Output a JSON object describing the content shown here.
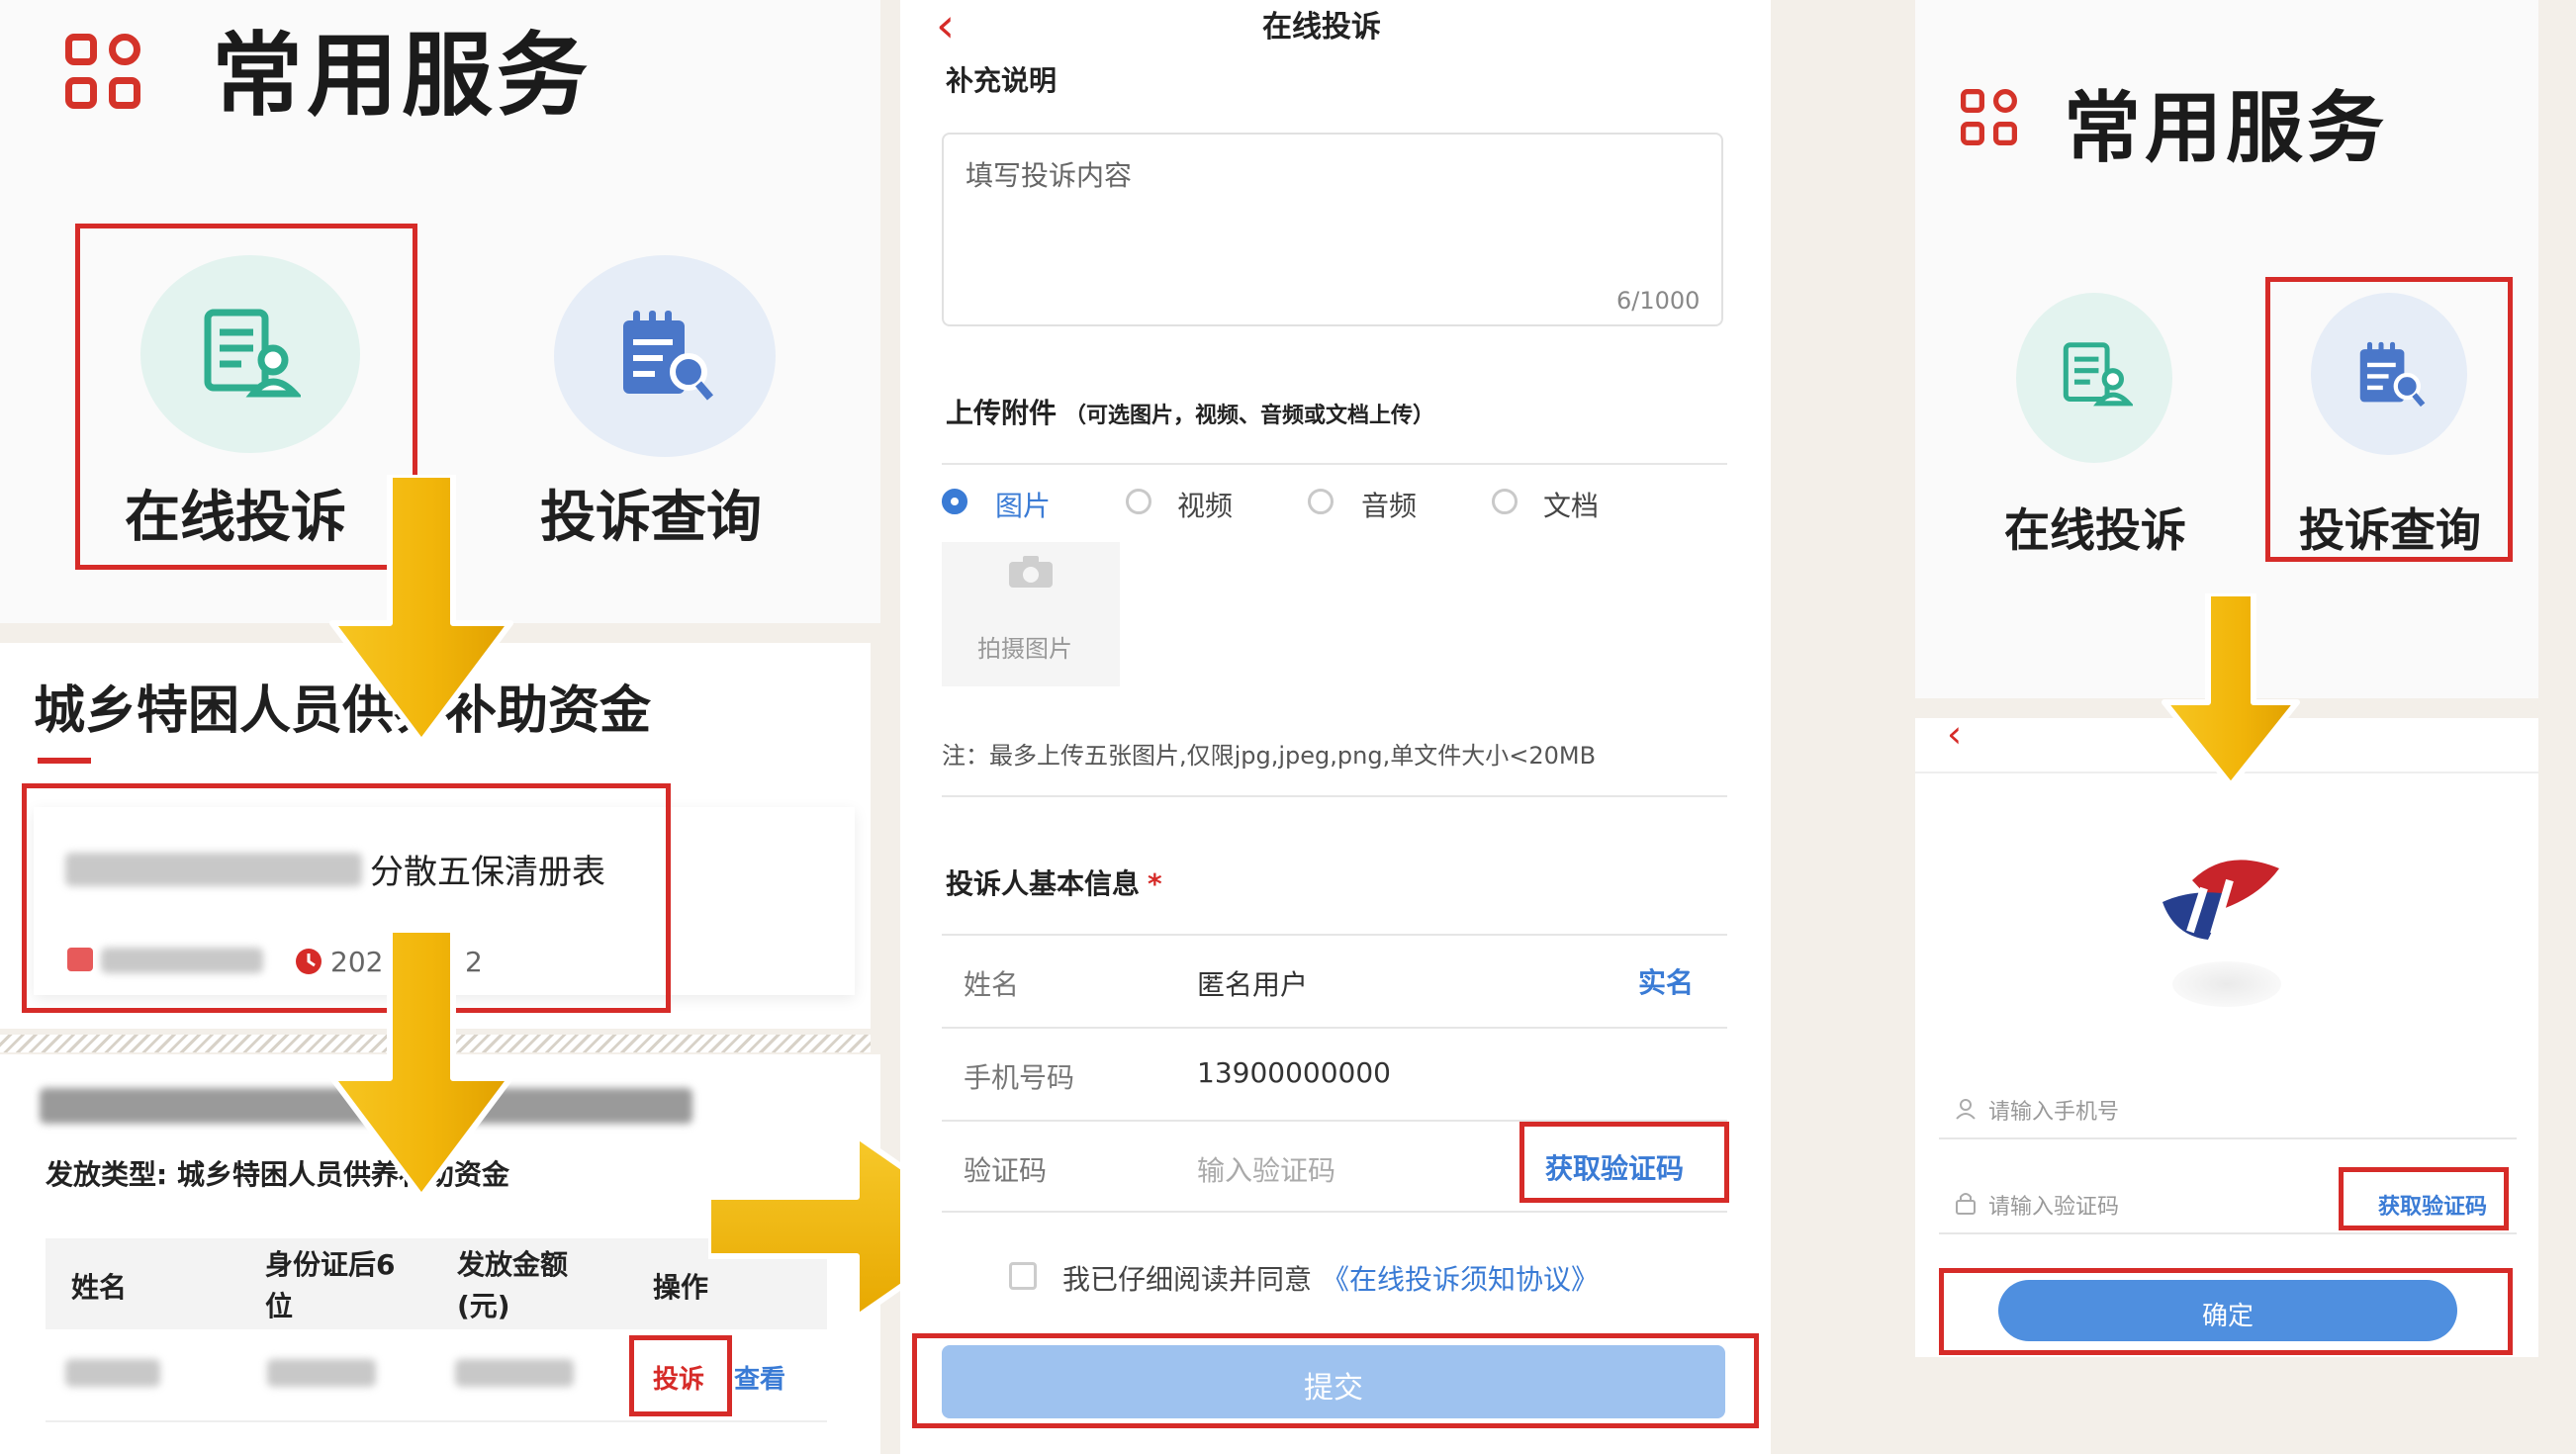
{
  "panel_left": {
    "service_title": "常用服务",
    "tile_online_complaint": "在线投诉",
    "tile_complaint_query": "投诉查询",
    "section_title": "城乡特困人员供养补助资金",
    "list_item_title": "分散五保清册表",
    "list_item_year": "202",
    "list_item_suffix": "2",
    "detail_type": "发放类型: 城乡特困人员供养补助资金",
    "table_headers": [
      "姓名",
      "身份证后6位",
      "发放金额(元)",
      "操作"
    ],
    "action_complain": "投诉",
    "action_view": "查看"
  },
  "panel_middle": {
    "nav_title": "在线投诉",
    "supplement_label": "补充说明",
    "complaint_placeholder": "填写投诉内容",
    "char_count": "6/1000",
    "upload_label": "上传附件",
    "upload_hint": "（可选图片，视频、音频或文档上传）",
    "upload_types": [
      "图片",
      "视频",
      "音频",
      "文档"
    ],
    "selected_type": "图片",
    "photo_button": "拍摄图片",
    "upload_note": "注：最多上传五张图片,仅限jpg,jpeg,png,单文件大小<20MB",
    "basic_info_label": "投诉人基本信息",
    "required_mark": "*",
    "name_label": "姓名",
    "name_value": "匿名用户",
    "realname_link": "实名",
    "phone_label": "手机号码",
    "phone_value": "13900000000",
    "code_label": "验证码",
    "code_placeholder": "输入验证码",
    "get_code_button": "获取验证码",
    "agree_text": "我已仔细阅读并同意",
    "agree_link": "《在线投诉须知协议》",
    "submit_button": "提交"
  },
  "panel_right": {
    "service_title": "常用服务",
    "tile_online_complaint": "在线投诉",
    "tile_complaint_query": "投诉查询",
    "phone_placeholder": "请输入手机号",
    "code_placeholder": "请输入验证码",
    "get_code_button": "获取验证码",
    "confirm_button": "确定"
  },
  "colors": {
    "accent_red": "#d62b28",
    "primary_blue": "#3a7bd5",
    "arrow_yellow": "#f0b400",
    "icon_green_bg": "#e3f3ef",
    "icon_blue_bg": "#e6edf7"
  },
  "icons": [
    "grid-icon",
    "document-person-icon",
    "calendar-search-icon",
    "arrow-down-icon",
    "arrow-right-icon",
    "back-chevron-icon",
    "camera-icon",
    "user-icon",
    "lock-icon",
    "clock-icon",
    "logo"
  ]
}
